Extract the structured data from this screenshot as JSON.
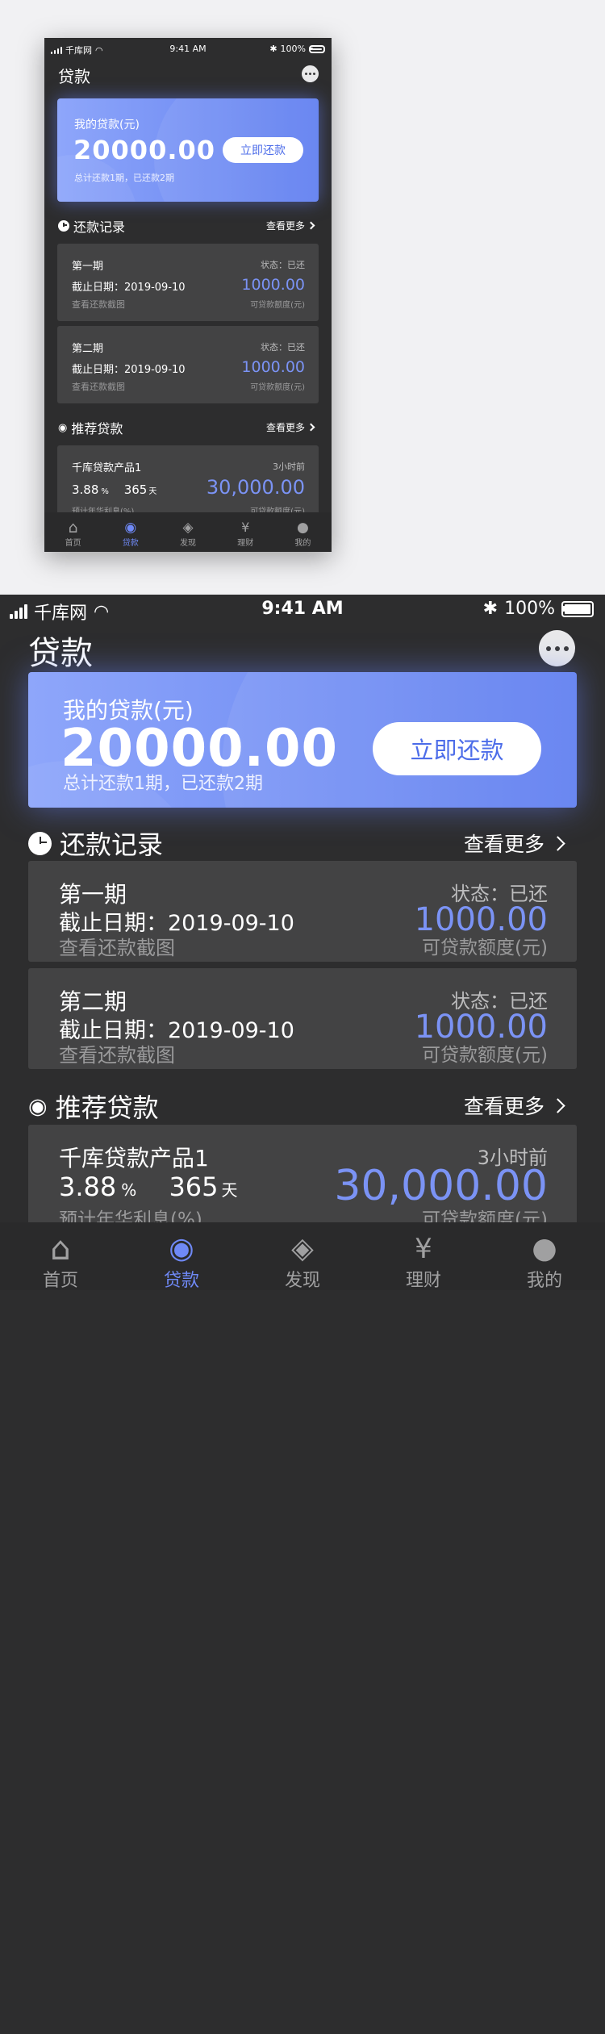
{
  "status": {
    "carrier": "千库网",
    "time": "9:41 AM",
    "battery": "100%"
  },
  "header": {
    "title": "贷款",
    "chat_icon": "chat-bubble-icon"
  },
  "loan_card": {
    "label": "我的贷款(元)",
    "amount": "20000.00",
    "summary": "总计还款1期，已还款2期",
    "repay_button": "立即还款",
    "gradient": [
      "#8ea6fa",
      "#5f7ef0"
    ]
  },
  "records": {
    "title": "还款记录",
    "more": "查看更多",
    "items": [
      {
        "period": "第一期",
        "due": "截止日期：2019-09-10",
        "link": "查看还款截图",
        "status": "状态：已还",
        "amount": "1000.00",
        "amount_label": "可贷款额度(元)"
      },
      {
        "period": "第二期",
        "due": "截止日期：2019-09-10",
        "link": "查看还款截图",
        "status": "状态：已还",
        "amount": "1000.00",
        "amount_label": "可贷款额度(元)"
      }
    ]
  },
  "recommend": {
    "title": "推荐贷款",
    "more": "查看更多",
    "items": [
      {
        "name": "千库贷款产品1",
        "rate": "3.88",
        "rate_unit": "%",
        "days": "365",
        "days_unit": "天",
        "rate_label": "预计年华利息(%)",
        "time": "3小时前",
        "amount": "30,000.00",
        "amount_label": "可贷款额度(元)"
      }
    ]
  },
  "tabbar": [
    {
      "label": "首页",
      "icon": "home-icon",
      "active": false
    },
    {
      "label": "贷款",
      "icon": "loan-coins-icon",
      "active": true
    },
    {
      "label": "发现",
      "icon": "compass-icon",
      "active": false
    },
    {
      "label": "理财",
      "icon": "yen-icon",
      "active": false
    },
    {
      "label": "我的",
      "icon": "user-icon",
      "active": false
    }
  ],
  "colors": {
    "accent": "#6f89f6",
    "background": "#2d2d2e",
    "card": "#434344"
  }
}
